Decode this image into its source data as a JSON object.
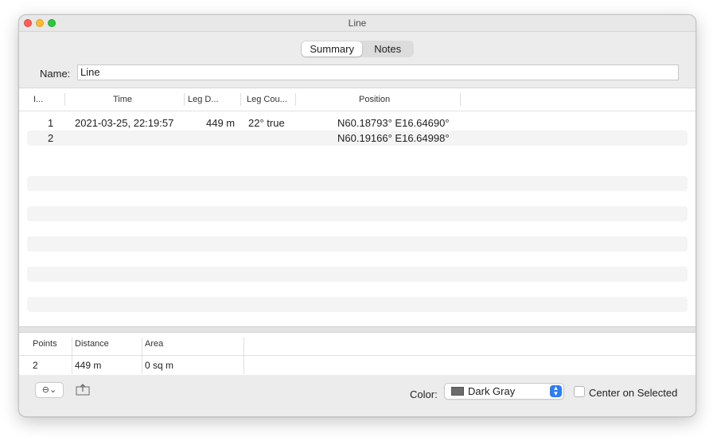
{
  "window": {
    "title": "Line"
  },
  "tabs": [
    {
      "label": "Summary",
      "active": true
    },
    {
      "label": "Notes",
      "active": false
    }
  ],
  "name": {
    "label": "Name:",
    "value": "Line"
  },
  "table": {
    "columns": [
      "I...",
      "Time",
      "Leg D...",
      "Leg Cou...",
      "Position"
    ],
    "rows": [
      {
        "index": "1",
        "time": "2021-03-25, 22:19:57",
        "leg_distance": "449 m",
        "leg_course": "22° true",
        "position": "N60.18793° E16.64690°"
      },
      {
        "index": "2",
        "time": "",
        "leg_distance": "",
        "leg_course": "",
        "position": "N60.19166° E16.64998°"
      }
    ]
  },
  "summary": {
    "columns": [
      "Points",
      "Distance",
      "Area"
    ],
    "values": [
      "2",
      "449 m",
      "0 sq m"
    ]
  },
  "bottom": {
    "action_glyph": "⊖⌄",
    "color_label": "Color:",
    "color_value": "Dark Gray",
    "color_swatch": "#6b6b6b",
    "center_label": "Center on Selected",
    "center_checked": false
  },
  "colors": {
    "accent": "#2f7bf6"
  }
}
